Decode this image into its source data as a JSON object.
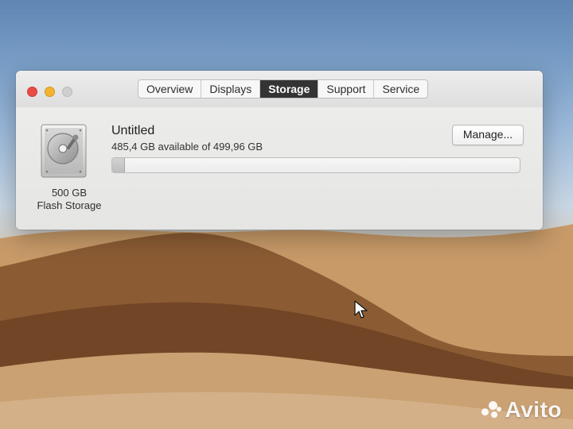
{
  "window": {
    "tabs": [
      {
        "label": "Overview",
        "active": false
      },
      {
        "label": "Displays",
        "active": false
      },
      {
        "label": "Storage",
        "active": true
      },
      {
        "label": "Support",
        "active": false
      },
      {
        "label": "Service",
        "active": false
      }
    ]
  },
  "storage": {
    "disk": {
      "capacity": "500 GB",
      "type": "Flash Storage"
    },
    "drive": {
      "name": "Untitled",
      "availability": "485,4 GB available of 499,96 GB",
      "used_fraction": 0.029
    },
    "manage_button": "Manage..."
  },
  "watermark": {
    "text": "Avito"
  },
  "icons": {
    "disk": "hard-drive-icon",
    "cursor": "mouse-pointer-icon"
  },
  "colors": {
    "close": "#ea4b45",
    "minimize": "#f2b32f",
    "zoom_disabled": "#cfcfcf",
    "active_tab": "#343434"
  }
}
